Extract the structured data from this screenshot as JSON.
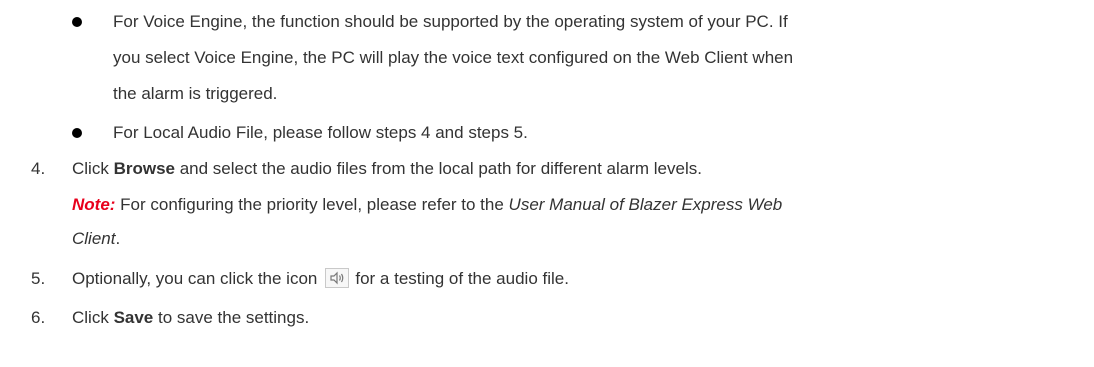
{
  "bullets": [
    {
      "lines": [
        "For Voice Engine, the function should be supported by the operating system of your PC. If",
        "you select Voice Engine, the PC will play the voice text configured on the Web Client when",
        "the alarm is triggered."
      ]
    },
    {
      "lines": [
        "For Local Audio File, please follow steps 4 and steps 5."
      ]
    }
  ],
  "steps": {
    "step4": {
      "number": "4.",
      "before": "Click ",
      "bold": "Browse",
      "after": " and select the audio files from the local path for different alarm levels.",
      "note_label": "Note:",
      "note_text": " For configuring the priority level, please refer to the ",
      "note_italic_1": "User Manual of Blazer Express Web",
      "note_italic_2": "Client",
      "note_end": "."
    },
    "step5": {
      "number": "5.",
      "before": "Optionally, you can click the icon",
      "icon": "speaker-icon",
      "after": "for a testing of the audio file."
    },
    "step6": {
      "number": "6.",
      "before": "Click ",
      "bold": "Save",
      "after": " to save the settings."
    }
  },
  "colors": {
    "text": "#333333",
    "note": "#e8001c",
    "bullet": "#000000"
  }
}
